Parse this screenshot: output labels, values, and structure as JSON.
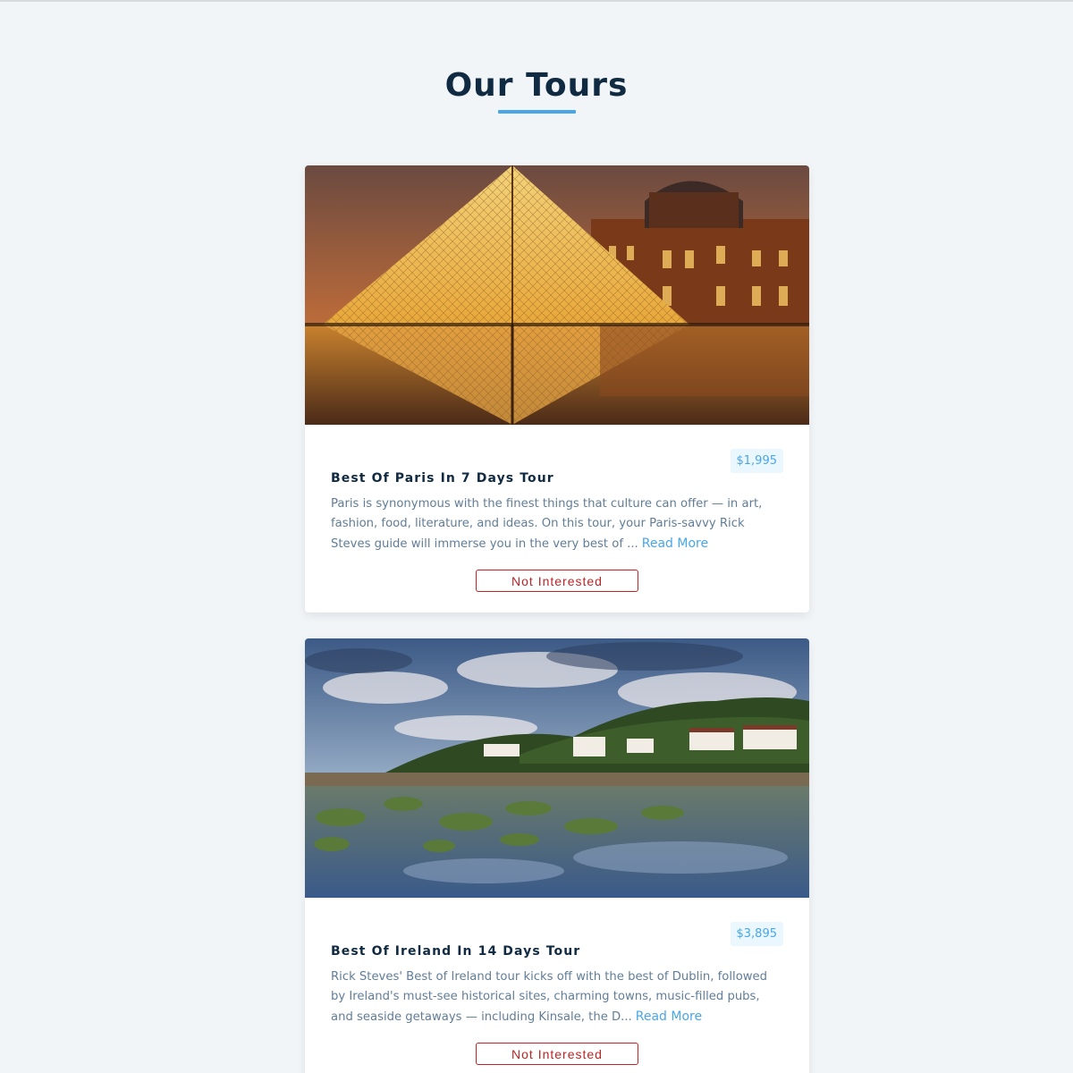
{
  "page": {
    "title": "Our Tours"
  },
  "colors": {
    "background": "#f1f5f8",
    "heading": "#102a42",
    "accent": "#49a6e9",
    "price_bg": "#ebf7ff",
    "danger": "#bb2525",
    "body_text": "#617d98"
  },
  "tours": [
    {
      "name": "Best Of Paris In 7 Days Tour",
      "price": "$1,995",
      "info": "Paris is synonymous with the finest things that culture can offer — in art, fashion, food, literature, and ideas. On this tour, your Paris-savvy Rick Steves guide will immerse you in the very best of ...",
      "read_more": "Read More",
      "button": "Not Interested",
      "image": "louvre-pyramid-photo"
    },
    {
      "name": "Best Of Ireland In 14 Days Tour",
      "price": "$3,895",
      "info": "Rick Steves' Best of Ireland tour kicks off with the best of Dublin, followed by Ireland's must-see historical sites, charming towns, music-filled pubs, and seaside getaways — including Kinsale, the D...",
      "read_more": "Read More",
      "button": "Not Interested",
      "image": "irish-coast-photo"
    }
  ]
}
